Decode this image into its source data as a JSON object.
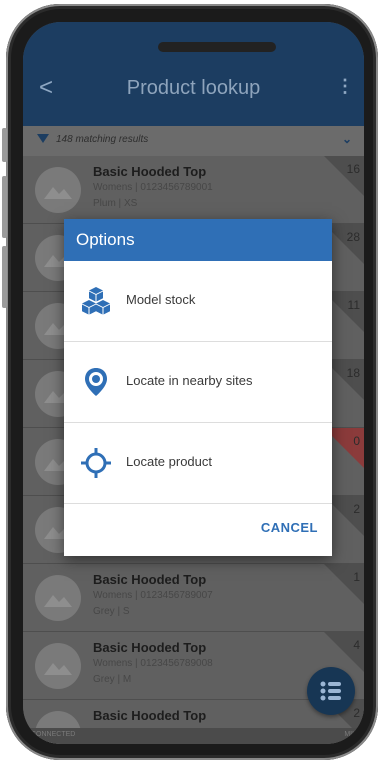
{
  "appbar": {
    "title": "Product lookup",
    "back_glyph": "<",
    "more_glyph": "⋮"
  },
  "filter": {
    "text": "148 matching results",
    "chevron": "⌄"
  },
  "rows": [
    {
      "name": "Basic Hooded Top",
      "sub1": "Womens | 0123456789001",
      "sub2": "Plum | XS",
      "qty": "16"
    },
    {
      "name": "",
      "sub1": "",
      "sub2": "",
      "qty": "28"
    },
    {
      "name": "",
      "sub1": "",
      "sub2": "",
      "qty": "11"
    },
    {
      "name": "",
      "sub1": "",
      "sub2": "",
      "qty": "18"
    },
    {
      "name": "",
      "sub1": "",
      "sub2": "",
      "qty": "0"
    },
    {
      "name": "",
      "sub1": "",
      "sub2": "",
      "qty": "2"
    },
    {
      "name": "Basic Hooded Top",
      "sub1": "Womens | 0123456789007",
      "sub2": "Grey | S",
      "qty": "1"
    },
    {
      "name": "Basic Hooded Top",
      "sub1": "Womens | 0123456789008",
      "sub2": "Grey | M",
      "qty": "4"
    },
    {
      "name": "Basic Hooded Top",
      "sub1": "",
      "sub2": "",
      "qty": "2"
    }
  ],
  "status": {
    "left": "CONNECTED",
    "right": "MIL"
  },
  "dialog": {
    "title": "Options",
    "options": [
      {
        "label": "Model stock",
        "icon": "cubes-icon"
      },
      {
        "label": "Locate in nearby sites",
        "icon": "location-pin-icon"
      },
      {
        "label": "Locate product",
        "icon": "crosshair-icon"
      }
    ],
    "cancel_label": "CANCEL"
  },
  "colors": {
    "primary": "#2f6fb6",
    "appbar": "#1c3d61",
    "out_of_stock": "#8b3b3b"
  }
}
